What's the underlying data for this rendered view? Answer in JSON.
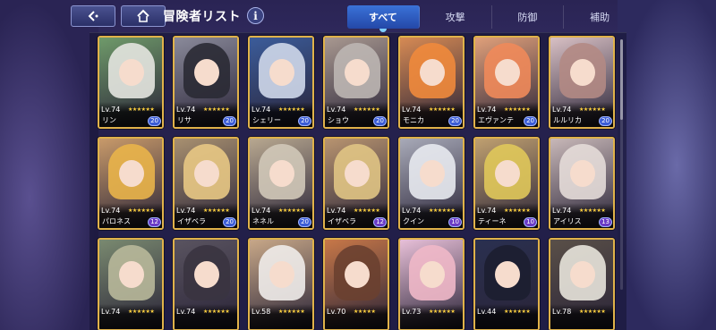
{
  "header": {
    "title": "冒険者リスト",
    "info_label": "i"
  },
  "tabs": [
    {
      "label": "すべて",
      "active": true
    },
    {
      "label": "攻撃",
      "active": false
    },
    {
      "label": "防御",
      "active": false
    },
    {
      "label": "補助",
      "active": false
    }
  ],
  "cards": [
    {
      "lv": "Lv.74",
      "name": "リン",
      "badge": "20",
      "stars": "★★★★★★",
      "hair": "#e4e6e0",
      "bg": "#6f9a6a"
    },
    {
      "lv": "Lv.74",
      "name": "リサ",
      "badge": "20",
      "stars": "★★★★★★",
      "hair": "#2a2a34",
      "bg": "#8a8a9a"
    },
    {
      "lv": "Lv.74",
      "name": "シェリー",
      "badge": "20",
      "stars": "★★★★★★",
      "hair": "#cfd8ea",
      "bg": "#3b5c9a"
    },
    {
      "lv": "Lv.74",
      "name": "ショウ",
      "badge": "20",
      "stars": "★★★★★★",
      "hair": "#bdb6b2",
      "bg": "#a89890"
    },
    {
      "lv": "Lv.74",
      "name": "モニカ",
      "badge": "20",
      "stars": "★★★★★★",
      "hair": "#f08a3c",
      "bg": "#d68a54"
    },
    {
      "lv": "Lv.74",
      "name": "エヴァンテ",
      "badge": "20",
      "stars": "★★★★★★",
      "hair": "#f08a5a",
      "bg": "#e0a07a"
    },
    {
      "lv": "Lv.74",
      "name": "ルルリカ",
      "badge": "20",
      "stars": "★★★★★★",
      "hair": "#b28a84",
      "bg": "#d8c0c4"
    },
    {
      "lv": "Lv.74",
      "name": "パロネス",
      "badge": "12",
      "stars": "★★★★★★",
      "hair": "#e9b44a",
      "bg": "#c89a6a"
    },
    {
      "lv": "Lv.74",
      "name": "イザベラ",
      "badge": "20",
      "stars": "★★★★★★",
      "hair": "#e8c884",
      "bg": "#a89070"
    },
    {
      "lv": "Lv.74",
      "name": "ネネル",
      "badge": "20",
      "stars": "★★★★★★",
      "hair": "#d0c8b8",
      "bg": "#b8a890"
    },
    {
      "lv": "Lv.74",
      "name": "イザベラ",
      "badge": "12",
      "stars": "★★★★★★",
      "hair": "#e0c484",
      "bg": "#b89470"
    },
    {
      "lv": "Lv.74",
      "name": "クイン",
      "badge": "10",
      "stars": "★★★★★★",
      "hair": "#e8eaf0",
      "bg": "#a8aab8"
    },
    {
      "lv": "Lv.74",
      "name": "ティーネ",
      "badge": "10",
      "stars": "★★★★★★",
      "hair": "#e0c85a",
      "bg": "#c0a070"
    },
    {
      "lv": "Lv.74",
      "name": "アイリス",
      "badge": "13",
      "stars": "★★★★★★",
      "hair": "#e4dcd8",
      "bg": "#c8b8b8"
    },
    {
      "lv": "Lv.74",
      "name": "",
      "badge": "",
      "stars": "★★★★★★",
      "hair": "#b8b89a",
      "bg": "#7a8a70"
    },
    {
      "lv": "Lv.74",
      "name": "",
      "badge": "",
      "stars": "★★★★★★",
      "hair": "#3a3440",
      "bg": "#5a5460"
    },
    {
      "lv": "Lv.58",
      "name": "",
      "badge": "",
      "stars": "★★★★★★",
      "hair": "#f0ecea",
      "bg": "#c8a888"
    },
    {
      "lv": "Lv.70",
      "name": "",
      "badge": "",
      "stars": "★★★★★",
      "hair": "#6a4030",
      "bg": "#c87848"
    },
    {
      "lv": "Lv.73",
      "name": "",
      "badge": "",
      "stars": "★★★★★★",
      "hair": "#f0b8c8",
      "bg": "#e8c0d8"
    },
    {
      "lv": "Lv.44",
      "name": "",
      "badge": "",
      "stars": "★★★★★★",
      "hair": "#1c1e30",
      "bg": "#2a3050"
    },
    {
      "lv": "Lv.78",
      "name": "",
      "badge": "",
      "stars": "★★★★★★",
      "hair": "#e8e4dc",
      "bg": "#5a5048"
    }
  ],
  "colors": {
    "accent_tab": "#3a72d8",
    "card_border": "#e0b24a",
    "star": "#ffd23f"
  },
  "icons": {
    "back": "back-arrow-icon",
    "home": "home-icon",
    "info": "info-icon"
  }
}
